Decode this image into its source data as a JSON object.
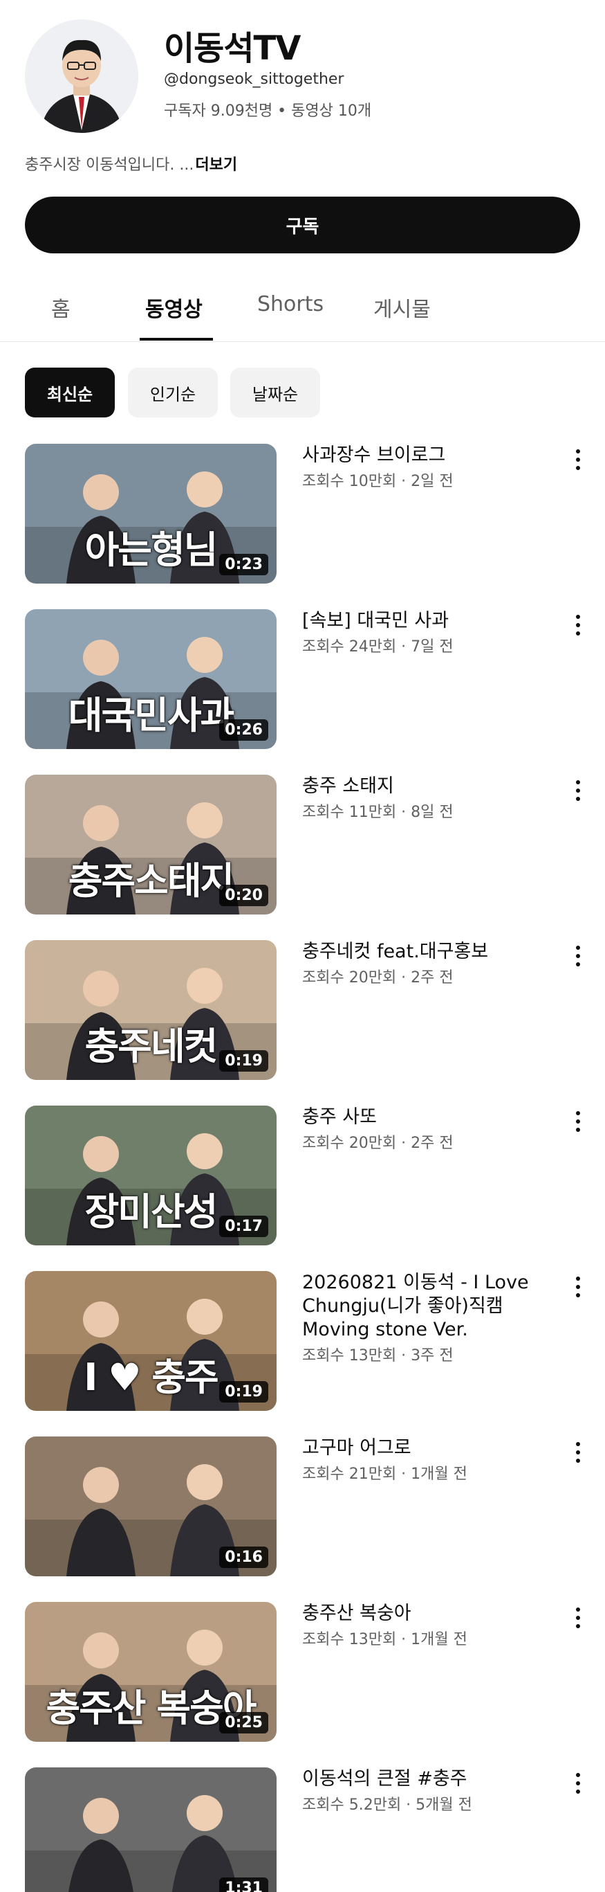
{
  "channel": {
    "title": "이동석TV",
    "handle": "@dongseok_sittogether",
    "stats": "구독자 9.09천명 • 동영상 10개",
    "description": "충주시장 이동석입니다. ...",
    "more_label": "더보기",
    "subscribe_label": "구독"
  },
  "tabs": [
    {
      "label": "홈",
      "active": false
    },
    {
      "label": "동영상",
      "active": true
    },
    {
      "label": "Shorts",
      "active": false
    },
    {
      "label": "게시물",
      "active": false
    }
  ],
  "chips": [
    {
      "label": "최신순",
      "active": true
    },
    {
      "label": "인기순",
      "active": false
    },
    {
      "label": "날짜순",
      "active": false
    }
  ],
  "videos": [
    {
      "title": "사과장수 브이로그",
      "meta": "조회수 10만회 · 2일 전",
      "duration": "0:23",
      "thumb_text": "아는형님",
      "thumb_color": "#7d8f9c"
    },
    {
      "title": "[속보] 대국민 사과",
      "meta": "조회수 24만회 · 7일 전",
      "duration": "0:26",
      "thumb_text": "대국민사과",
      "thumb_color": "#8fa3b3"
    },
    {
      "title": "충주 소태지",
      "meta": "조회수 11만회 · 8일 전",
      "duration": "0:20",
      "thumb_text": "충주소태지",
      "thumb_color": "#b8a89a"
    },
    {
      "title": "충주네컷 feat.대구홍보",
      "meta": "조회수 20만회 · 2주 전",
      "duration": "0:19",
      "thumb_text": "충주네컷",
      "thumb_color": "#c9b49b"
    },
    {
      "title": "충주 사또",
      "meta": "조회수 20만회 · 2주 전",
      "duration": "0:17",
      "thumb_text": "장미산성",
      "thumb_color": "#6f7f69"
    },
    {
      "title": "20260821 이동석 - I Love Chungju(니가 좋아)직캠 Moving stone Ver.",
      "meta": "조회수 13만회 · 3주 전",
      "duration": "0:19",
      "thumb_text": "I ♥ 충주",
      "thumb_color": "#a58766"
    },
    {
      "title": "고구마 어그로",
      "meta": "조회수 21만회 · 1개월 전",
      "duration": "0:16",
      "thumb_text": "",
      "thumb_color": "#8e7a66"
    },
    {
      "title": "충주산 복숭아",
      "meta": "조회수 13만회 · 1개월 전",
      "duration": "0:25",
      "thumb_text": "충주산 복숭아",
      "thumb_color": "#b99e83"
    },
    {
      "title": "이동석의 큰절 #충주",
      "meta": "조회수 5.2만회 · 5개월 전",
      "duration": "1:31",
      "thumb_text": "",
      "thumb_color": "#6b6b6b"
    }
  ]
}
